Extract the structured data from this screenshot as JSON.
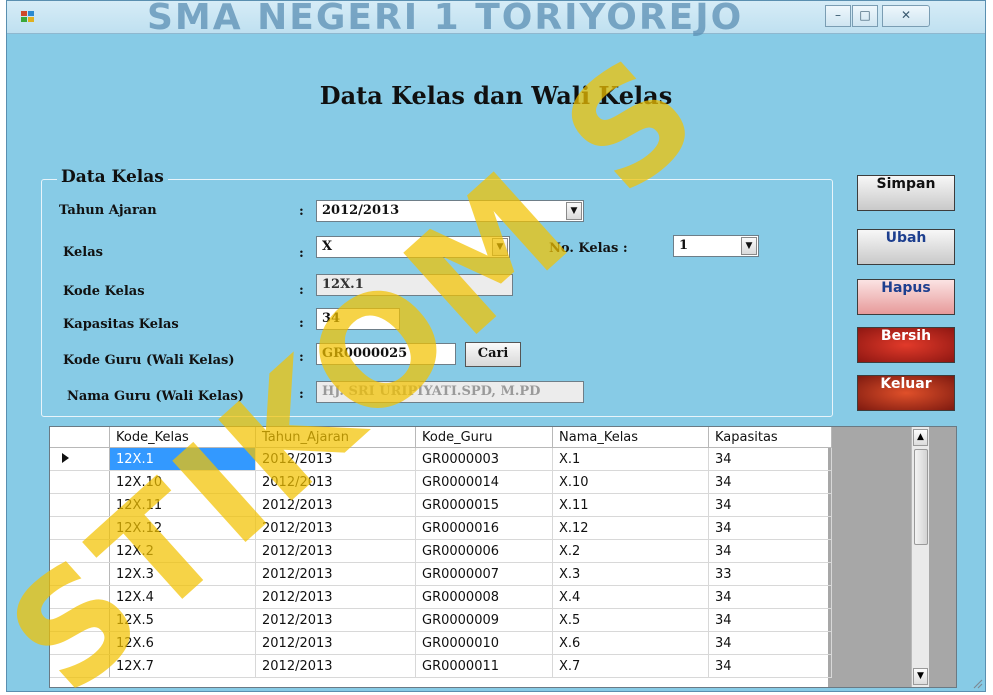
{
  "window": {
    "title": "SMA NEGERI 1 TORIYOREJO",
    "controls": {
      "minimize": "–",
      "maximize": "□",
      "close": "✕"
    }
  },
  "form": {
    "title": "Data Kelas dan Wali Kelas"
  },
  "group": {
    "title": "Data Kelas",
    "colon": ":",
    "fields": {
      "tahun_ajaran": {
        "label": "Tahun Ajaran",
        "value": "2012/2013"
      },
      "kelas": {
        "label": "Kelas",
        "value": "X"
      },
      "no_kelas": {
        "label": "No. Kelas  :",
        "value": "1"
      },
      "kode_kelas": {
        "label": "Kode Kelas",
        "value": "12X.1"
      },
      "kapasitas_kelas": {
        "label": "Kapasitas Kelas",
        "value": "34"
      },
      "kode_guru": {
        "label": "Kode Guru (Wali Kelas)",
        "value": "GR0000025"
      },
      "nama_guru": {
        "label": "Nama Guru (Wali Kelas)",
        "value": "HJ. SRI URIPIYATI.SPD, M.PD"
      }
    },
    "cari_button": "Cari"
  },
  "buttons": {
    "simpan": "Simpan",
    "ubah": "Ubah",
    "hapus": "Hapus",
    "bersih": "Bersih",
    "keluar": "Keluar"
  },
  "grid": {
    "columns": [
      "Kode_Kelas",
      "Tahun_Ajaran",
      "Kode_Guru",
      "Nama_Kelas",
      "Kapasitas"
    ],
    "rows": [
      [
        "12X.1",
        "2012/2013",
        "GR0000003",
        "X.1",
        "34"
      ],
      [
        "12X.10",
        "2012/2013",
        "GR0000014",
        "X.10",
        "34"
      ],
      [
        "12X.11",
        "2012/2013",
        "GR0000015",
        "X.11",
        "34"
      ],
      [
        "12X.12",
        "2012/2013",
        "GR0000016",
        "X.12",
        "34"
      ],
      [
        "12X.2",
        "2012/2013",
        "GR0000006",
        "X.2",
        "34"
      ],
      [
        "12X.3",
        "2012/2013",
        "GR0000007",
        "X.3",
        "33"
      ],
      [
        "12X.4",
        "2012/2013",
        "GR0000008",
        "X.4",
        "34"
      ],
      [
        "12X.5",
        "2012/2013",
        "GR0000009",
        "X.5",
        "34"
      ],
      [
        "12X.6",
        "2012/2013",
        "GR0000010",
        "X.6",
        "34"
      ],
      [
        "12X.7",
        "2012/2013",
        "GR0000011",
        "X.7",
        "34"
      ]
    ],
    "selected_row": 0
  },
  "colors": {
    "form_background": "#87cbe6",
    "selection": "#3399ff",
    "watermark": "#f2c200",
    "button_accent": "#c0262b"
  },
  "watermark_text": "STIKOM S"
}
